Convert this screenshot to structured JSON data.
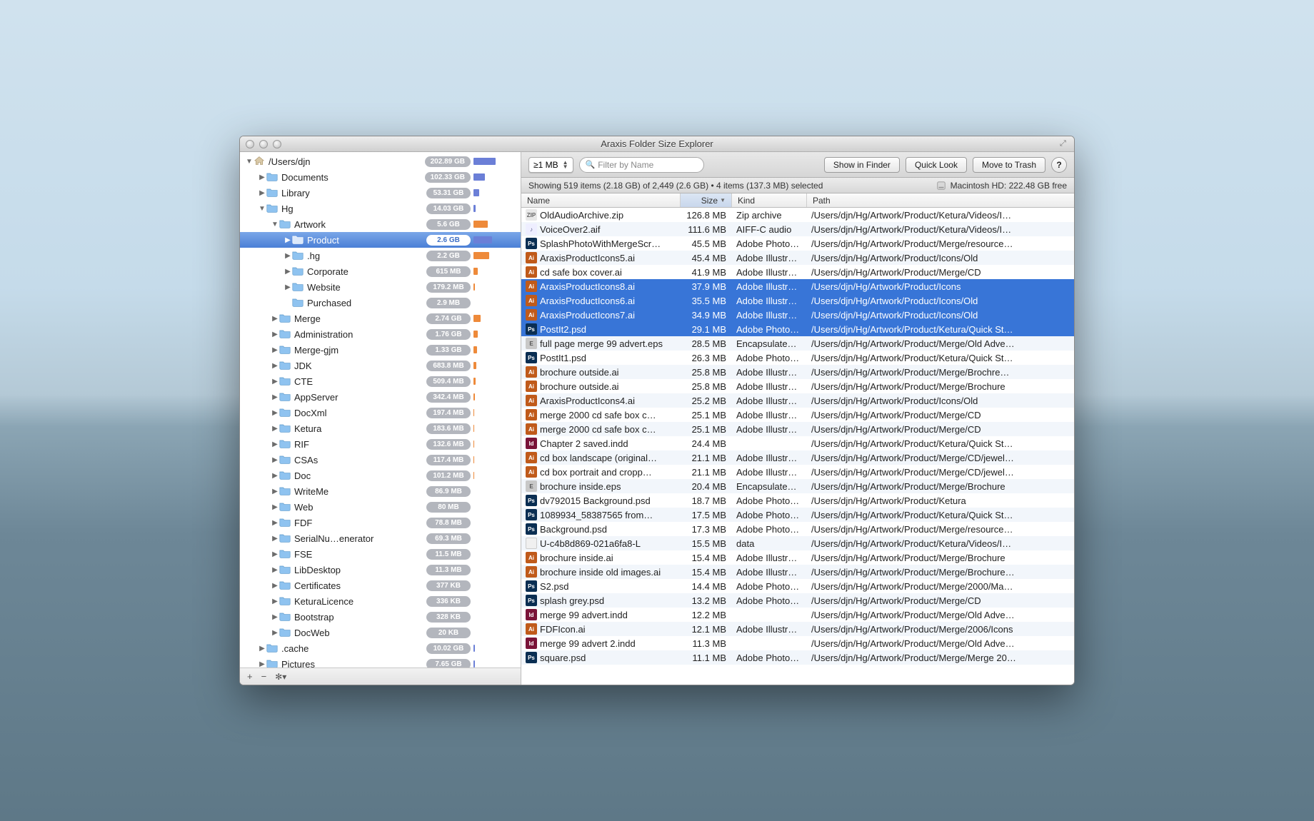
{
  "window": {
    "title": "Araxis Folder Size Explorer"
  },
  "toolbar": {
    "filter_select": "≥1 MB",
    "search_placeholder": "Filter by Name",
    "btn_show": "Show in Finder",
    "btn_quicklook": "Quick Look",
    "btn_trash": "Move to Trash",
    "btn_help": "?"
  },
  "status": {
    "summary": "Showing 519 items (2.18 GB) of 2,449 (2.6 GB) • 4 items (137.3 MB) selected",
    "disk": "Macintosh HD: 222.48 GB free"
  },
  "columns": {
    "name": "Name",
    "size": "Size",
    "kind": "Kind",
    "path": "Path"
  },
  "tree": [
    {
      "depth": 0,
      "arrow": "down",
      "icon": "home",
      "name": "/Users/djn",
      "size": "202.89 GB",
      "bar": 31,
      "color": "blue"
    },
    {
      "depth": 1,
      "arrow": "right",
      "icon": "folder",
      "name": "Documents",
      "size": "102.33 GB",
      "bar": 16,
      "color": "blue"
    },
    {
      "depth": 1,
      "arrow": "right",
      "icon": "folder",
      "name": "Library",
      "size": "53.31 GB",
      "bar": 8,
      "color": "blue"
    },
    {
      "depth": 1,
      "arrow": "down",
      "icon": "folder",
      "name": "Hg",
      "size": "14.03 GB",
      "bar": 3,
      "color": "blue"
    },
    {
      "depth": 2,
      "arrow": "down",
      "icon": "folder",
      "name": "Artwork",
      "size": "5.6 GB",
      "bar": 20,
      "color": "orange"
    },
    {
      "depth": 3,
      "arrow": "right",
      "icon": "folder-sel",
      "name": "Product",
      "size": "2.6 GB",
      "bar": 26,
      "color": "blue",
      "selected": true
    },
    {
      "depth": 3,
      "arrow": "right",
      "icon": "folder",
      "name": ".hg",
      "size": "2.2 GB",
      "bar": 22,
      "color": "orange"
    },
    {
      "depth": 3,
      "arrow": "right",
      "icon": "folder",
      "name": "Corporate",
      "size": "615 MB",
      "bar": 6,
      "color": "orange"
    },
    {
      "depth": 3,
      "arrow": "right",
      "icon": "folder",
      "name": "Website",
      "size": "179.2 MB",
      "bar": 2,
      "color": "orange"
    },
    {
      "depth": 3,
      "arrow": "none",
      "icon": "folder",
      "name": "Purchased",
      "size": "2.9 MB",
      "bar": 0,
      "color": "orange"
    },
    {
      "depth": 2,
      "arrow": "right",
      "icon": "folder",
      "name": "Merge",
      "size": "2.74 GB",
      "bar": 10,
      "color": "orange"
    },
    {
      "depth": 2,
      "arrow": "right",
      "icon": "folder",
      "name": "Administration",
      "size": "1.76 GB",
      "bar": 6,
      "color": "orange"
    },
    {
      "depth": 2,
      "arrow": "right",
      "icon": "folder",
      "name": "Merge-gjm",
      "size": "1.33 GB",
      "bar": 5,
      "color": "orange"
    },
    {
      "depth": 2,
      "arrow": "right",
      "icon": "folder",
      "name": "JDK",
      "size": "683.8 MB",
      "bar": 4,
      "color": "orange"
    },
    {
      "depth": 2,
      "arrow": "right",
      "icon": "folder",
      "name": "CTE",
      "size": "509.4 MB",
      "bar": 3,
      "color": "orange"
    },
    {
      "depth": 2,
      "arrow": "right",
      "icon": "folder",
      "name": "AppServer",
      "size": "342.4 MB",
      "bar": 2,
      "color": "orange"
    },
    {
      "depth": 2,
      "arrow": "right",
      "icon": "folder",
      "name": "DocXml",
      "size": "197.4 MB",
      "bar": 1,
      "color": "orange"
    },
    {
      "depth": 2,
      "arrow": "right",
      "icon": "folder",
      "name": "Ketura",
      "size": "183.6 MB",
      "bar": 1,
      "color": "orange"
    },
    {
      "depth": 2,
      "arrow": "right",
      "icon": "folder",
      "name": "RIF",
      "size": "132.6 MB",
      "bar": 1,
      "color": "orange"
    },
    {
      "depth": 2,
      "arrow": "right",
      "icon": "folder",
      "name": "CSAs",
      "size": "117.4 MB",
      "bar": 1,
      "color": "orange"
    },
    {
      "depth": 2,
      "arrow": "right",
      "icon": "folder",
      "name": "Doc",
      "size": "101.2 MB",
      "bar": 1,
      "color": "orange"
    },
    {
      "depth": 2,
      "arrow": "right",
      "icon": "folder",
      "name": "WriteMe",
      "size": "86.9 MB",
      "bar": 0,
      "color": "orange"
    },
    {
      "depth": 2,
      "arrow": "right",
      "icon": "folder",
      "name": "Web",
      "size": "80 MB",
      "bar": 0,
      "color": "orange"
    },
    {
      "depth": 2,
      "arrow": "right",
      "icon": "folder",
      "name": "FDF",
      "size": "78.8 MB",
      "bar": 0,
      "color": "orange"
    },
    {
      "depth": 2,
      "arrow": "right",
      "icon": "folder",
      "name": "SerialNu…enerator",
      "size": "69.3 MB",
      "bar": 0,
      "color": "orange"
    },
    {
      "depth": 2,
      "arrow": "right",
      "icon": "folder",
      "name": "FSE",
      "size": "11.5 MB",
      "bar": 0,
      "color": "orange"
    },
    {
      "depth": 2,
      "arrow": "right",
      "icon": "folder",
      "name": "LibDesktop",
      "size": "11.3 MB",
      "bar": 0,
      "color": "orange"
    },
    {
      "depth": 2,
      "arrow": "right",
      "icon": "folder",
      "name": "Certificates",
      "size": "377 KB",
      "bar": 0,
      "color": "orange"
    },
    {
      "depth": 2,
      "arrow": "right",
      "icon": "folder",
      "name": "KeturaLicence",
      "size": "336 KB",
      "bar": 0,
      "color": "orange"
    },
    {
      "depth": 2,
      "arrow": "right",
      "icon": "folder",
      "name": "Bootstrap",
      "size": "328 KB",
      "bar": 0,
      "color": "orange"
    },
    {
      "depth": 2,
      "arrow": "right",
      "icon": "folder",
      "name": "DocWeb",
      "size": "20 KB",
      "bar": 0,
      "color": "orange"
    },
    {
      "depth": 1,
      "arrow": "right",
      "icon": "folder",
      "name": ".cache",
      "size": "10.02 GB",
      "bar": 2,
      "color": "blue"
    },
    {
      "depth": 1,
      "arrow": "right",
      "icon": "folder",
      "name": "Pictures",
      "size": "7.65 GB",
      "bar": 2,
      "color": "blue"
    }
  ],
  "files": [
    {
      "icon": "zip",
      "name": "OldAudioArchive.zip",
      "size": "126.8 MB",
      "kind": "Zip archive",
      "path": "/Users/djn/Hg/Artwork/Product/Ketura/Videos/I…"
    },
    {
      "icon": "aif",
      "name": "VoiceOver2.aif",
      "size": "111.6 MB",
      "kind": "AIFF-C audio",
      "path": "/Users/djn/Hg/Artwork/Product/Ketura/Videos/I…"
    },
    {
      "icon": "psd",
      "name": "SplashPhotoWithMergeScr…",
      "size": "45.5 MB",
      "kind": "Adobe Photo…",
      "path": "/Users/djn/Hg/Artwork/Product/Merge/resource…"
    },
    {
      "icon": "ai",
      "name": "AraxisProductIcons5.ai",
      "size": "45.4 MB",
      "kind": "Adobe Illustr…",
      "path": "/Users/djn/Hg/Artwork/Product/Icons/Old"
    },
    {
      "icon": "ai",
      "name": "cd safe box cover.ai",
      "size": "41.9 MB",
      "kind": "Adobe Illustr…",
      "path": "/Users/djn/Hg/Artwork/Product/Merge/CD"
    },
    {
      "icon": "ai",
      "name": "AraxisProductIcons8.ai",
      "size": "37.9 MB",
      "kind": "Adobe Illustr…",
      "path": "/Users/djn/Hg/Artwork/Product/Icons",
      "selected": true
    },
    {
      "icon": "ai",
      "name": "AraxisProductIcons6.ai",
      "size": "35.5 MB",
      "kind": "Adobe Illustr…",
      "path": "/Users/djn/Hg/Artwork/Product/Icons/Old",
      "selected": true
    },
    {
      "icon": "ai",
      "name": "AraxisProductIcons7.ai",
      "size": "34.9 MB",
      "kind": "Adobe Illustr…",
      "path": "/Users/djn/Hg/Artwork/Product/Icons/Old",
      "selected": true
    },
    {
      "icon": "psd",
      "name": "PostIt2.psd",
      "size": "29.1 MB",
      "kind": "Adobe Photo…",
      "path": "/Users/djn/Hg/Artwork/Product/Ketura/Quick St…",
      "selected": true
    },
    {
      "icon": "eps",
      "name": "full page merge 99 advert.eps",
      "size": "28.5 MB",
      "kind": "Encapsulate…",
      "path": "/Users/djn/Hg/Artwork/Product/Merge/Old Adve…"
    },
    {
      "icon": "psd",
      "name": "PostIt1.psd",
      "size": "26.3 MB",
      "kind": "Adobe Photo…",
      "path": "/Users/djn/Hg/Artwork/Product/Ketura/Quick St…"
    },
    {
      "icon": "ai",
      "name": "brochure outside.ai",
      "size": "25.8 MB",
      "kind": "Adobe Illustr…",
      "path": "/Users/djn/Hg/Artwork/Product/Merge/Brochre…"
    },
    {
      "icon": "ai",
      "name": "brochure outside.ai",
      "size": "25.8 MB",
      "kind": "Adobe Illustr…",
      "path": "/Users/djn/Hg/Artwork/Product/Merge/Brochure"
    },
    {
      "icon": "ai",
      "name": "AraxisProductIcons4.ai",
      "size": "25.2 MB",
      "kind": "Adobe Illustr…",
      "path": "/Users/djn/Hg/Artwork/Product/Icons/Old"
    },
    {
      "icon": "ai",
      "name": "merge 2000 cd safe box c…",
      "size": "25.1 MB",
      "kind": "Adobe Illustr…",
      "path": "/Users/djn/Hg/Artwork/Product/Merge/CD"
    },
    {
      "icon": "ai",
      "name": "merge 2000 cd safe box c…",
      "size": "25.1 MB",
      "kind": "Adobe Illustr…",
      "path": "/Users/djn/Hg/Artwork/Product/Merge/CD"
    },
    {
      "icon": "indd",
      "name": "Chapter 2 saved.indd",
      "size": "24.4 MB",
      "kind": "",
      "path": "/Users/djn/Hg/Artwork/Product/Ketura/Quick St…"
    },
    {
      "icon": "ai",
      "name": "cd box landscape (original…",
      "size": "21.1 MB",
      "kind": "Adobe Illustr…",
      "path": "/Users/djn/Hg/Artwork/Product/Merge/CD/jewel…"
    },
    {
      "icon": "ai",
      "name": "cd box portrait and cropp…",
      "size": "21.1 MB",
      "kind": "Adobe Illustr…",
      "path": "/Users/djn/Hg/Artwork/Product/Merge/CD/jewel…"
    },
    {
      "icon": "eps",
      "name": "brochure inside.eps",
      "size": "20.4 MB",
      "kind": "Encapsulate…",
      "path": "/Users/djn/Hg/Artwork/Product/Merge/Brochure"
    },
    {
      "icon": "psd",
      "name": "dv792015 Background.psd",
      "size": "18.7 MB",
      "kind": "Adobe Photo…",
      "path": "/Users/djn/Hg/Artwork/Product/Ketura"
    },
    {
      "icon": "psd",
      "name": "1089934_58387565 from…",
      "size": "17.5 MB",
      "kind": "Adobe Photo…",
      "path": "/Users/djn/Hg/Artwork/Product/Ketura/Quick St…"
    },
    {
      "icon": "psd",
      "name": "Background.psd",
      "size": "17.3 MB",
      "kind": "Adobe Photo…",
      "path": "/Users/djn/Hg/Artwork/Product/Merge/resource…"
    },
    {
      "icon": "blank",
      "name": "U-c4b8d869-021a6fa8-L",
      "size": "15.5 MB",
      "kind": "data",
      "path": "/Users/djn/Hg/Artwork/Product/Ketura/Videos/I…"
    },
    {
      "icon": "ai",
      "name": "brochure inside.ai",
      "size": "15.4 MB",
      "kind": "Adobe Illustr…",
      "path": "/Users/djn/Hg/Artwork/Product/Merge/Brochure"
    },
    {
      "icon": "ai",
      "name": "brochure inside old images.ai",
      "size": "15.4 MB",
      "kind": "Adobe Illustr…",
      "path": "/Users/djn/Hg/Artwork/Product/Merge/Brochure…"
    },
    {
      "icon": "psd",
      "name": "S2.psd",
      "size": "14.4 MB",
      "kind": "Adobe Photo…",
      "path": "/Users/djn/Hg/Artwork/Product/Merge/2000/Ma…"
    },
    {
      "icon": "psd",
      "name": "splash grey.psd",
      "size": "13.2 MB",
      "kind": "Adobe Photo…",
      "path": "/Users/djn/Hg/Artwork/Product/Merge/CD"
    },
    {
      "icon": "indd",
      "name": "merge 99 advert.indd",
      "size": "12.2 MB",
      "kind": "",
      "path": "/Users/djn/Hg/Artwork/Product/Merge/Old Adve…"
    },
    {
      "icon": "ai",
      "name": "FDFIcon.ai",
      "size": "12.1 MB",
      "kind": "Adobe Illustr…",
      "path": "/Users/djn/Hg/Artwork/Product/Merge/2006/Icons"
    },
    {
      "icon": "indd",
      "name": "merge 99 advert 2.indd",
      "size": "11.3 MB",
      "kind": "",
      "path": "/Users/djn/Hg/Artwork/Product/Merge/Old Adve…"
    },
    {
      "icon": "psd",
      "name": "square.psd",
      "size": "11.1 MB",
      "kind": "Adobe Photo…",
      "path": "/Users/djn/Hg/Artwork/Product/Merge/Merge 20…"
    }
  ]
}
